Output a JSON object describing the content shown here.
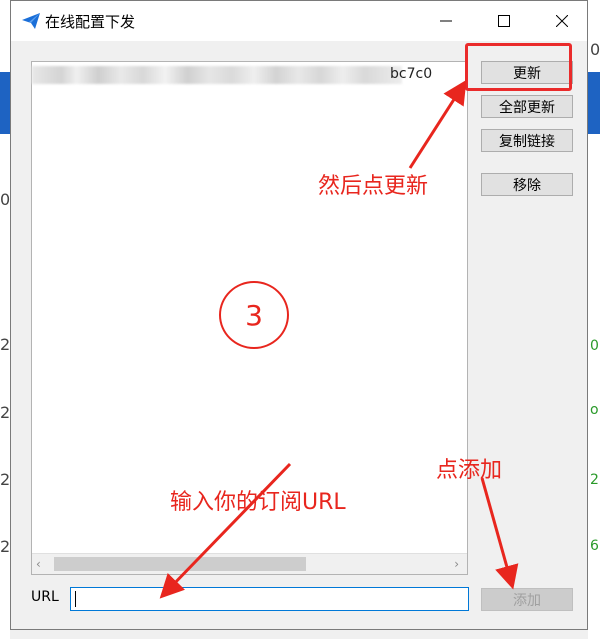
{
  "window": {
    "title": "在线配置下发",
    "controls": [
      "minimize-icon",
      "maximize-icon",
      "close-icon"
    ]
  },
  "list": {
    "rows": [
      {
        "visible_text": "bc7c0",
        "blurred": true
      }
    ]
  },
  "buttons": {
    "update": "更新",
    "update_all": "全部更新",
    "copy_link": "复制链接",
    "remove": "移除",
    "add": "添加"
  },
  "url_field": {
    "label": "URL",
    "value": ""
  },
  "annotations": {
    "step_number": "3",
    "update_hint": "然后点更新",
    "add_hint": "点添加",
    "url_hint": "输入你的订阅URL",
    "color": "#e8261e"
  },
  "background": {
    "left_chars": [
      "0",
      "2",
      "2",
      "2",
      "2"
    ],
    "right_chars": [
      "0",
      "0",
      "o",
      "2",
      "6"
    ],
    "accent": "#1e63c2",
    "status_green": "#2a9a2a"
  }
}
